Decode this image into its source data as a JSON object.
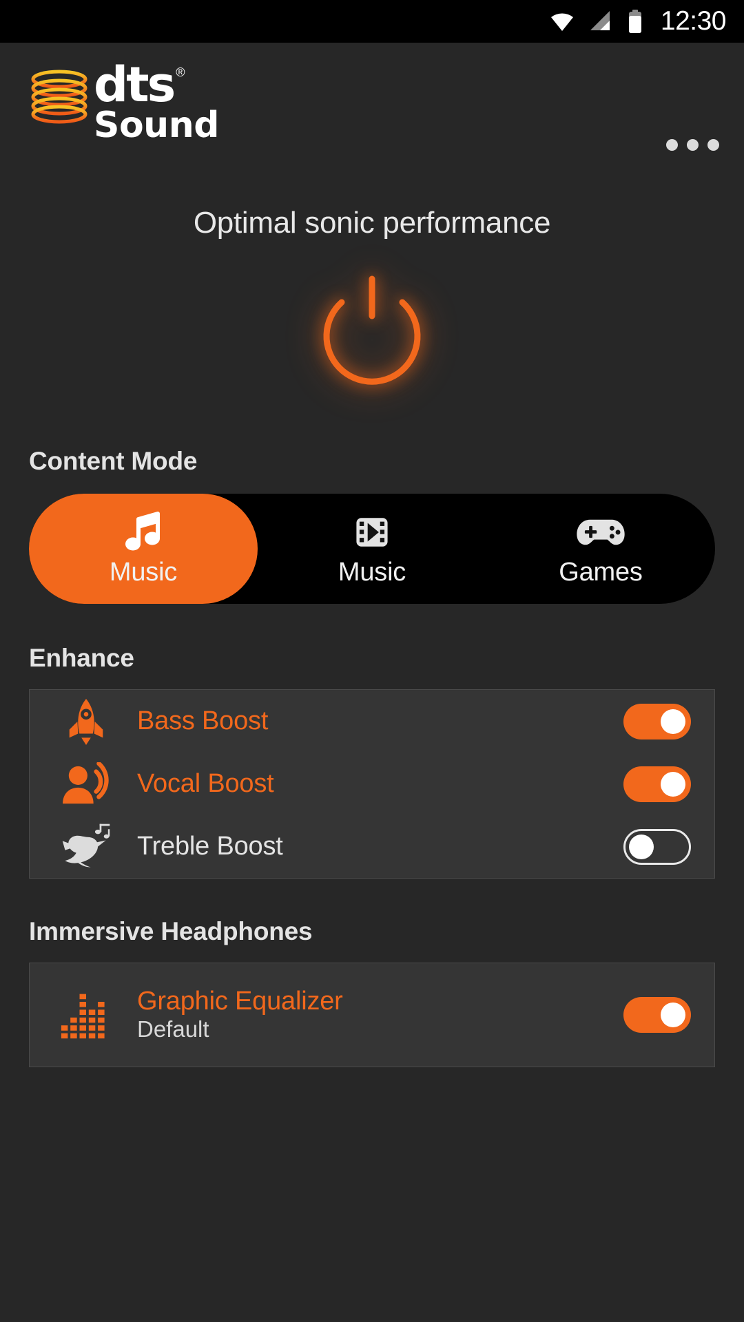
{
  "status_bar": {
    "time": "12:30",
    "icons": [
      "wifi-icon",
      "cell-signal-icon",
      "battery-icon"
    ]
  },
  "header": {
    "brand_primary": "dts",
    "brand_registered": "®",
    "brand_secondary": "Sound",
    "overflow_label": "More options"
  },
  "hero": {
    "status_text": "Optimal sonic performance",
    "power_state": "on",
    "accent_color": "#f2681c"
  },
  "content_mode": {
    "title": "Content Mode",
    "tabs": [
      {
        "label": "Music",
        "icon": "music-note-icon",
        "selected": true
      },
      {
        "label": "Music",
        "icon": "film-play-icon",
        "selected": false
      },
      {
        "label": "Games",
        "icon": "gamepad-icon",
        "selected": false
      }
    ]
  },
  "enhance": {
    "title": "Enhance",
    "items": [
      {
        "label": "Bass Boost",
        "icon": "rocket-icon",
        "enabled": true,
        "subtitle": ""
      },
      {
        "label": "Vocal Boost",
        "icon": "person-voice-icon",
        "enabled": true,
        "subtitle": ""
      },
      {
        "label": "Treble Boost",
        "icon": "songbird-icon",
        "enabled": false,
        "subtitle": ""
      }
    ]
  },
  "immersive": {
    "title": "Immersive Headphones",
    "items": [
      {
        "label": "Graphic Equalizer",
        "icon": "equalizer-icon",
        "enabled": true,
        "subtitle": "Default"
      }
    ]
  },
  "colors": {
    "accent": "#f2681c",
    "background": "#272727",
    "card": "#353535",
    "tabbar": "#000000",
    "text_primary": "#e8e8e8"
  }
}
